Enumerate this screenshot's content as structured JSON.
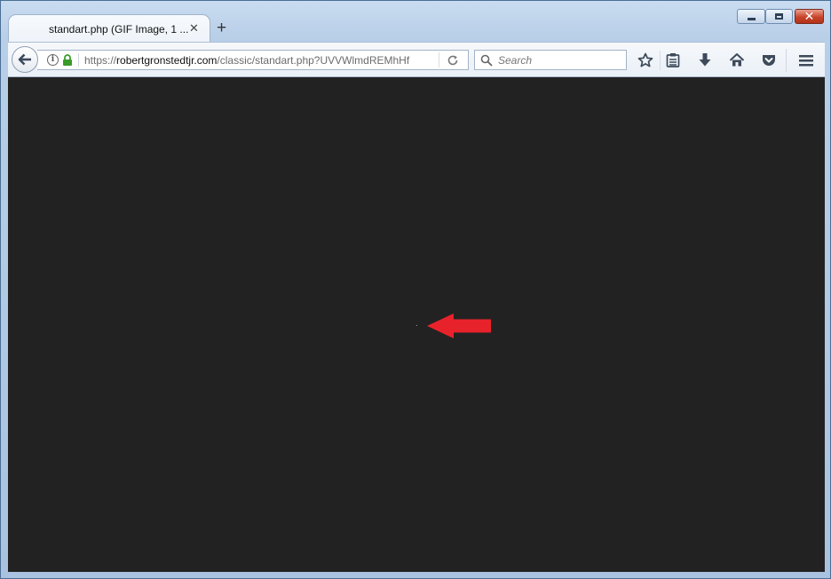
{
  "browser": {
    "tab": {
      "title": "standart.php (GIF Image, 1 ...",
      "close_glyph": "✕"
    },
    "new_tab_glyph": "+",
    "window_controls": {
      "close_glyph": "✕"
    },
    "address_bar": {
      "url_prefix": "https://",
      "url_domain": "robertgronstedtjr.com",
      "url_path": "/classic/standart.php?UVVWlmdREMhHf",
      "info_glyph": "i"
    },
    "search_bar": {
      "placeholder": "Search"
    }
  },
  "content": {
    "background_color": "#222222",
    "annotation_arrow_color": "#e8222b"
  },
  "icons": [
    "back-arrow-icon",
    "info-icon",
    "lock-icon",
    "reload-icon",
    "search-icon",
    "bookmark-star-icon",
    "library-icon",
    "download-icon",
    "home-icon",
    "pocket-icon",
    "menu-icon"
  ]
}
